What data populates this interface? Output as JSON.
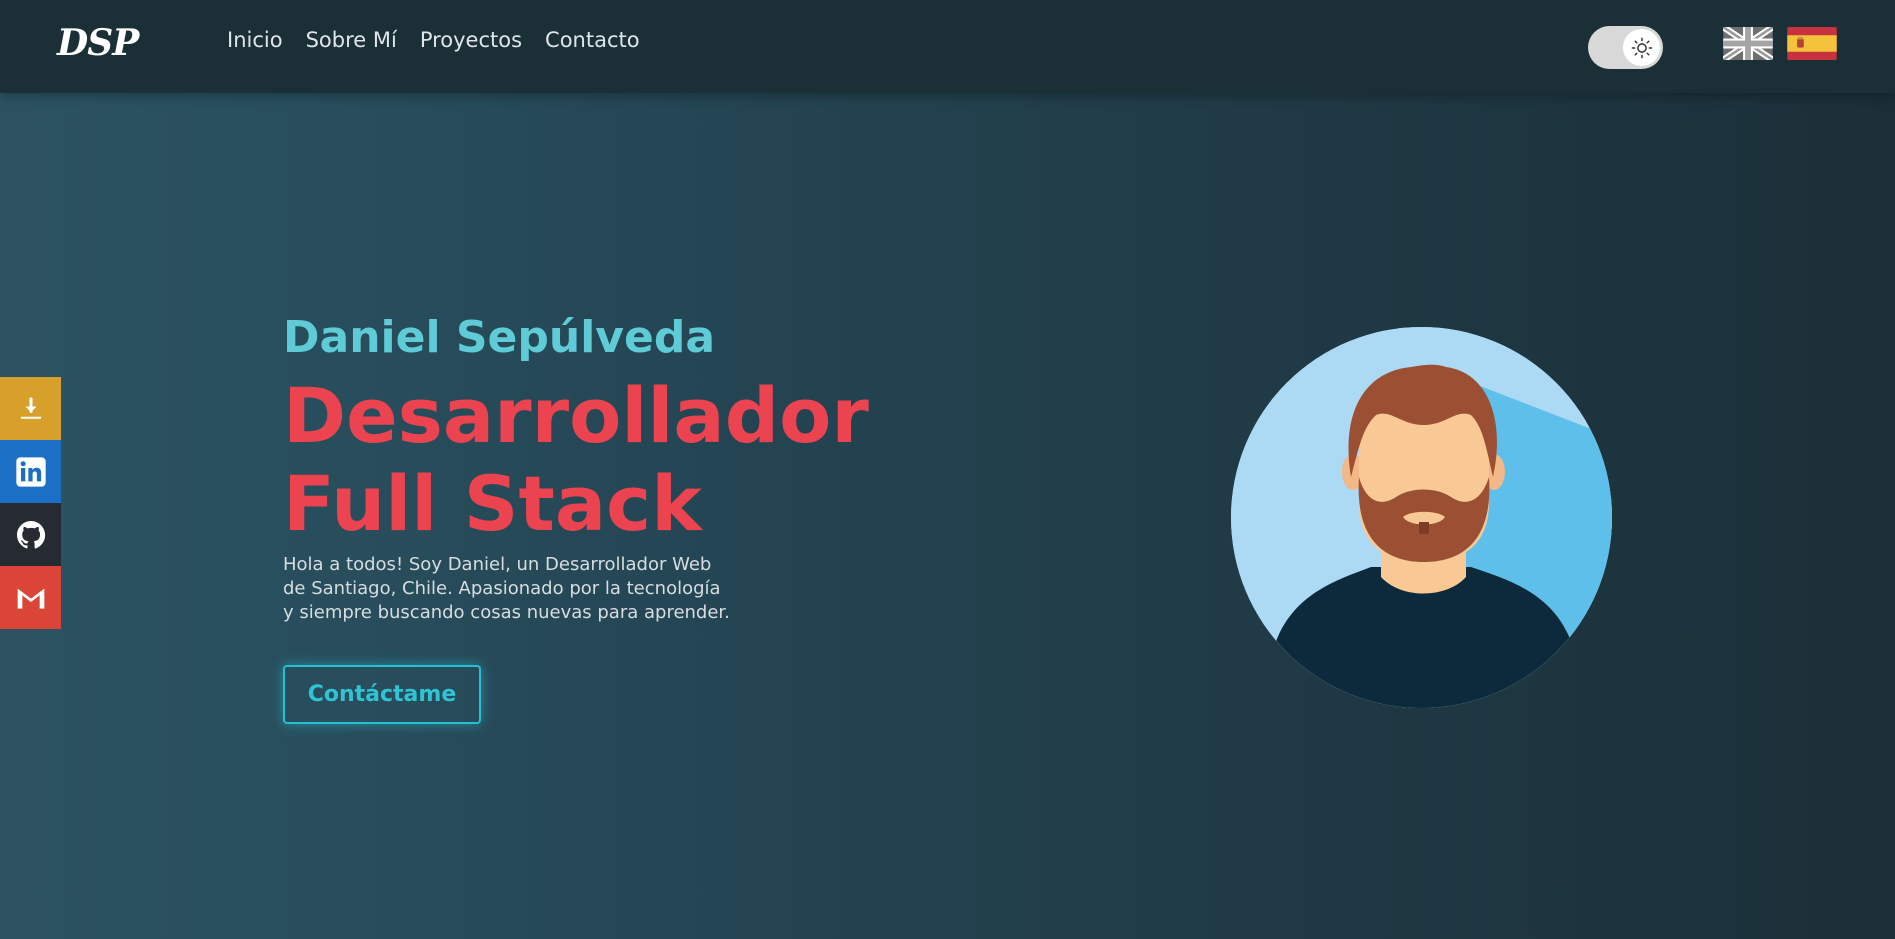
{
  "nav": {
    "logo": "DSP",
    "links": [
      "Inicio",
      "Sobre Mí",
      "Proyectos",
      "Contacto"
    ]
  },
  "theme_toggle": {
    "icon": "sun-icon"
  },
  "languages": [
    {
      "icon": "uk-flag-icon"
    },
    {
      "icon": "spain-flag-icon"
    }
  ],
  "social": [
    {
      "icon": "download-icon",
      "color": "#d6a02a"
    },
    {
      "icon": "linkedin-icon",
      "color": "#1b6fc4"
    },
    {
      "icon": "github-icon",
      "color": "#262b31"
    },
    {
      "icon": "gmail-icon",
      "color": "#db4537"
    }
  ],
  "hero": {
    "name": "Daniel Sepúlveda",
    "role": "Desarrollador Full Stack",
    "description": "Hola a todos! Soy Daniel, un Desarrollador Web de Santiago, Chile. Apasionado por la tecnología y siempre buscando cosas nuevas para aprender.",
    "cta_label": "Contáctame"
  },
  "colors": {
    "accent": "#5fcbd6",
    "title": "#ec4350",
    "navbar": "#1b2f37"
  }
}
